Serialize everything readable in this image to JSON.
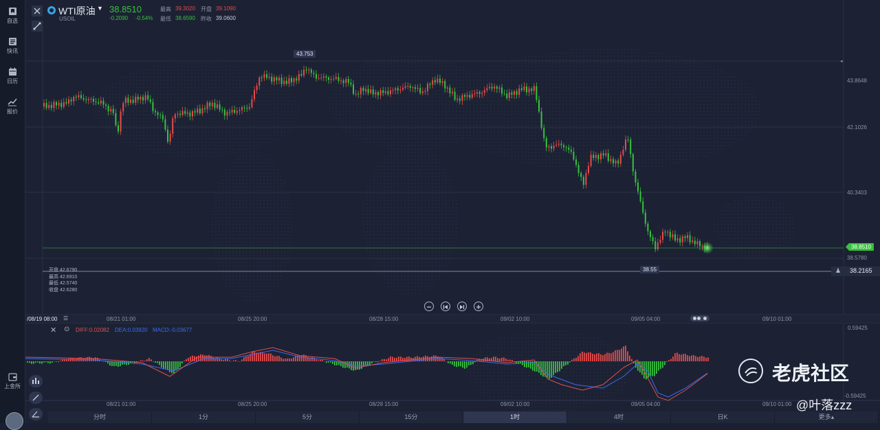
{
  "sidebar": {
    "items": [
      {
        "label": "自选",
        "icon": "bookmark-icon"
      },
      {
        "label": "快讯",
        "icon": "news-icon"
      },
      {
        "label": "日历",
        "icon": "calendar-icon"
      },
      {
        "label": "报价",
        "icon": "trend-icon"
      }
    ],
    "bottom_label": "上金所"
  },
  "header": {
    "symbol": "WTI原油",
    "code": "USOIL",
    "price": "38.8510",
    "change": "-0.2090",
    "change_pct": "-0.54%",
    "stats": {
      "high_label": "最高",
      "high": "39.3020",
      "open_label": "开盘",
      "open": "39.1090",
      "low_label": "最低",
      "low": "38.6590",
      "prev_label": "昨收",
      "prev": "39.0600"
    }
  },
  "main_chart": {
    "peak_label": "43.753",
    "low_label": "38.55",
    "price_axis": [
      "43.8648",
      "42.1026",
      "40.3403",
      "38.5780"
    ],
    "current_price_tag": "38.8510",
    "crosshair_price": "38.2165",
    "ohlc_box": {
      "open_label": "开盘",
      "open": "42.6790",
      "high_label": "最高",
      "high": "42.6910",
      "low_label": "最低",
      "low": "42.5740",
      "close_label": "收盘",
      "close": "42.6280"
    },
    "time_axis": [
      "/08/19 08:00",
      "08/21 01:00",
      "08/25 20:00",
      "08/28 15:00",
      "09/02 10:00",
      "09/05 04:00",
      "09/10 01:00"
    ]
  },
  "macd": {
    "diff": "DIFF:0.02082",
    "dea": "DEA:0.03920",
    "macd": "MACD:-0.03677",
    "axis_top": "0.59425",
    "axis_bottom": "-0.59425",
    "time_axis": [
      "08/21 01:00",
      "08/25 20:00",
      "08/28 15:00",
      "09/02 10:00",
      "09/05 04:00",
      "09/10 01:00"
    ]
  },
  "tabs": [
    "分时",
    "1分",
    "5分",
    "15分",
    "1时",
    "4时",
    "日K",
    "更多▴"
  ],
  "active_tab": "1时",
  "watermark": {
    "brand": "老虎社区",
    "user": "@叶落zzz"
  },
  "colors": {
    "up": "#e84a4a",
    "down": "#37c23e",
    "accent": "#3aa4e6",
    "dea_line": "#3b6cf0",
    "diff_line": "#e05050"
  }
}
